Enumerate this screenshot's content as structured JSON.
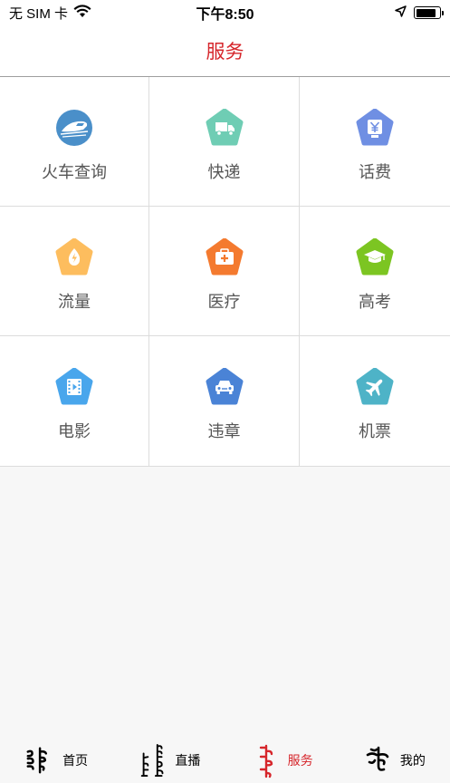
{
  "status_bar": {
    "carrier": "无 SIM 卡",
    "time": "下午8:50",
    "battery_level": 0.85
  },
  "nav": {
    "title": "服务"
  },
  "services": [
    {
      "label": "火车查询",
      "icon": "train-icon",
      "color": "#4a8fc9"
    },
    {
      "label": "快递",
      "icon": "delivery-truck-icon",
      "color": "#6fcdb4"
    },
    {
      "label": "话费",
      "icon": "yen-icon",
      "color": "#6f8fe3"
    },
    {
      "label": "流量",
      "icon": "data-flow-icon",
      "color": "#fdbd5e"
    },
    {
      "label": "医疗",
      "icon": "medical-kit-icon",
      "color": "#f47a2f"
    },
    {
      "label": "高考",
      "icon": "graduation-cap-icon",
      "color": "#7cc522"
    },
    {
      "label": "电影",
      "icon": "film-icon",
      "color": "#49a6ec"
    },
    {
      "label": "违章",
      "icon": "car-icon",
      "color": "#4a83d6"
    },
    {
      "label": "机票",
      "icon": "airplane-icon",
      "color": "#4eb3c7"
    }
  ],
  "tabs": [
    {
      "label": "首页",
      "icon": "home-mongolian-icon",
      "active": false
    },
    {
      "label": "直播",
      "icon": "live-mongolian-icon",
      "active": false
    },
    {
      "label": "服务",
      "icon": "service-mongolian-icon",
      "active": true
    },
    {
      "label": "我的",
      "icon": "profile-mongolian-icon",
      "active": false
    }
  ],
  "colors": {
    "accent": "#d6262b",
    "divider": "#dcdcdc",
    "background": "#f7f7f7"
  }
}
